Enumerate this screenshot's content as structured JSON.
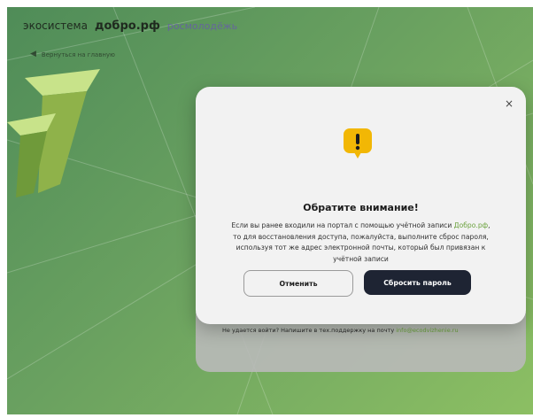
{
  "header": {
    "brand_part1": "экосистема",
    "brand_part2": "добро.рф",
    "brand_part3": "росмолодёжь",
    "back_link": "Вернуться на главную"
  },
  "modal": {
    "title": "Обратите внимание!",
    "message_before": "Если вы ранее входили на портал с помощью учётной записи ",
    "message_link": "Добро.рф",
    "message_after": ", то для восстановления доступа, пожалуйста, выполните сброс пароля, используя тот же адрес электронной почты, который был привязан к учётной записи",
    "cancel_label": "Отменить",
    "reset_label": "Сбросить пароль",
    "close_glyph": "×"
  },
  "footer": {
    "support_text": "Не удается войти? Напишите в тех.поддержку на почту ",
    "support_email": "info@ecodvizhenie.ru"
  },
  "colors": {
    "accent_green": "#6aa13c",
    "dark_button": "#1e2433",
    "warning": "#f2b705"
  },
  "icons": {
    "back": "back-arrow-icon",
    "close": "close-icon",
    "warning": "warning-icon"
  }
}
